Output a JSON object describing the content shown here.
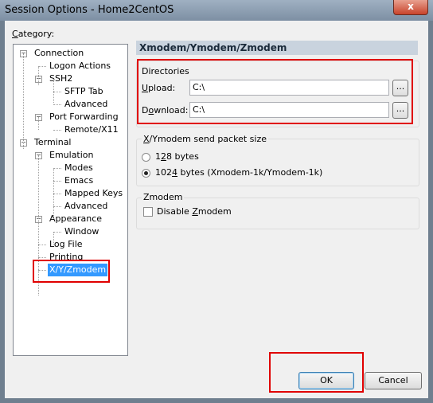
{
  "window": {
    "title": "Session Options - Home2CentOS",
    "close_glyph": "x"
  },
  "category": {
    "label_prefix": "",
    "label_underlined": "C",
    "label_rest": "ategory:"
  },
  "tree": {
    "items": [
      {
        "label": "Connection",
        "expander": "−"
      },
      {
        "label": "Logon Actions"
      },
      {
        "label": "SSH2",
        "expander": "−"
      },
      {
        "label": "SFTP Tab"
      },
      {
        "label": "Advanced"
      },
      {
        "label": "Port Forwarding",
        "expander": "−"
      },
      {
        "label": "Remote/X11"
      },
      {
        "label": "Terminal",
        "expander": "−"
      },
      {
        "label": "Emulation",
        "expander": "−"
      },
      {
        "label": "Modes"
      },
      {
        "label": "Emacs"
      },
      {
        "label": "Mapped Keys"
      },
      {
        "label": "Advanced"
      },
      {
        "label": "Appearance",
        "expander": "−"
      },
      {
        "label": "Window"
      },
      {
        "label": "Log File"
      },
      {
        "label": "Printing"
      },
      {
        "label": "X/Y/Zmodem",
        "selected": true
      }
    ]
  },
  "panel": {
    "header": "Xmodem/Ymodem/Zmodem",
    "directories": {
      "title": "Directories",
      "upload_label_u": "U",
      "upload_label_rest": "pload:",
      "upload_value": "C:\\",
      "download_label_pre": "D",
      "download_label_u": "o",
      "download_label_rest": "wnload:",
      "download_value": "C:\\",
      "browse_label": "..."
    },
    "packet": {
      "title_u": "X",
      "title_rest": "/Ymodem send packet size",
      "option_128_pre": "1",
      "option_128_u": "2",
      "option_128_rest": "8 bytes",
      "option_1024_pre": "102",
      "option_1024_u": "4",
      "option_1024_rest": " bytes  (Xmodem-1k/Ymodem-1k)",
      "selected": "1024"
    },
    "zmodem": {
      "title": "Zmodem",
      "disable_pre": "Disable ",
      "disable_u": "Z",
      "disable_rest": "modem",
      "checked": false
    }
  },
  "buttons": {
    "ok": "OK",
    "cancel": "Cancel"
  }
}
